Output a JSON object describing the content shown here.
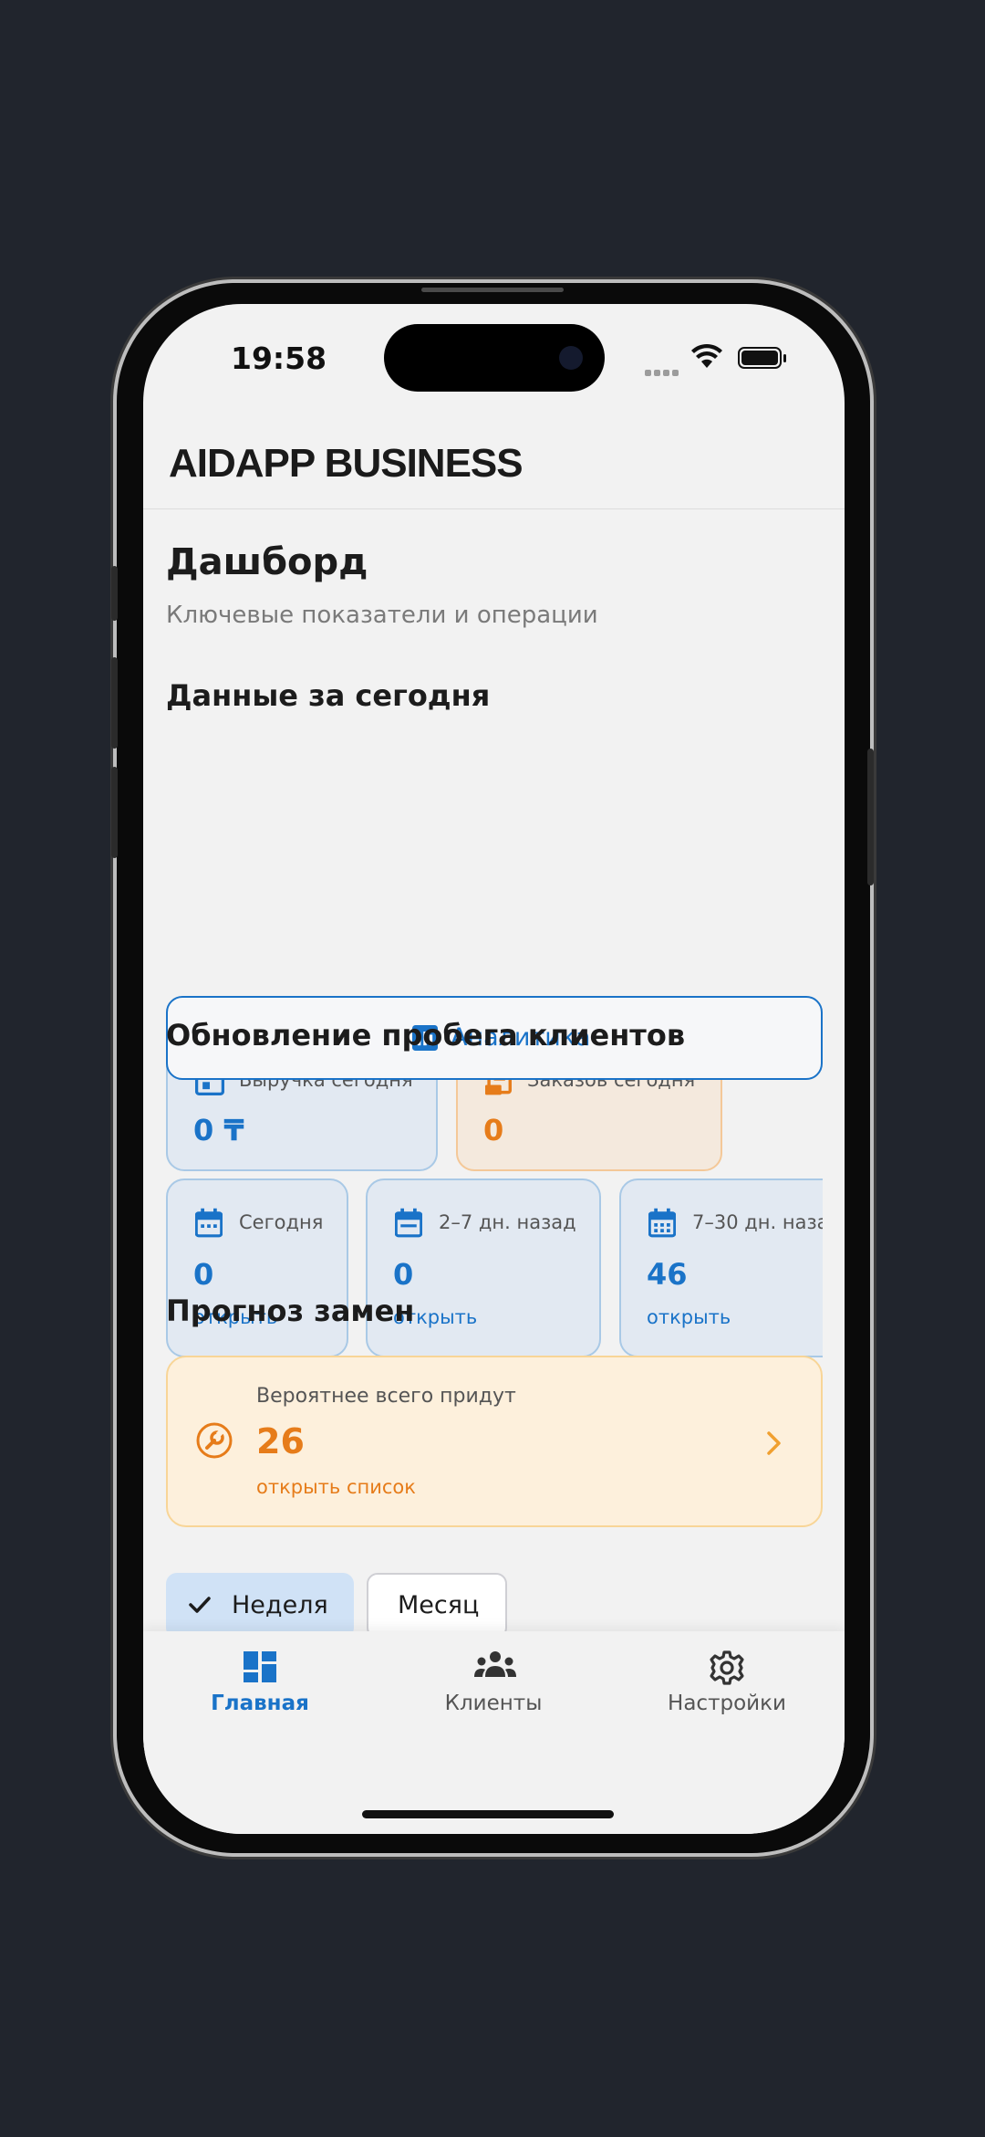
{
  "status": {
    "time": "19:58"
  },
  "app": {
    "title": "AIDAPP BUSINESS"
  },
  "dashboard": {
    "title": "Дашборд",
    "subtitle": "Ключевые показатели и операции"
  },
  "today": {
    "heading": "Данные за сегодня",
    "revenue": {
      "label": "Выручка сегодня",
      "value": "0 ₸",
      "icon": "calendar-icon"
    },
    "orders": {
      "label": "Заказов сегодня",
      "value": "0",
      "icon": "receipt-icon"
    }
  },
  "analytics_button": {
    "label": "Аналитика",
    "icon": "bar-chart-icon"
  },
  "mileage": {
    "heading": "Обновление пробега клиентов",
    "cards": [
      {
        "label": "Сегодня",
        "value": "0",
        "link": "открыть"
      },
      {
        "label": "2–7 дн. назад",
        "value": "0",
        "link": "открыть"
      },
      {
        "label": "7–30 дн. наза",
        "value": "46",
        "link": "открыть"
      }
    ]
  },
  "forecast": {
    "heading": "Прогноз замен",
    "label": "Вероятнее всего придут",
    "value": "26",
    "link": "открыть список",
    "icon": "wrench-icon"
  },
  "period": {
    "options": [
      {
        "label": "Неделя",
        "selected": true
      },
      {
        "label": "Месяц",
        "selected": false
      }
    ]
  },
  "nav": {
    "items": [
      {
        "label": "Главная",
        "icon": "dashboard-icon",
        "active": true
      },
      {
        "label": "Клиенты",
        "icon": "clients-icon",
        "active": false
      },
      {
        "label": "Настройки",
        "icon": "gear-icon",
        "active": false
      }
    ]
  },
  "colors": {
    "accent": "#1a73c8",
    "orange": "#e67c1a",
    "background": "#f2f2f2"
  }
}
